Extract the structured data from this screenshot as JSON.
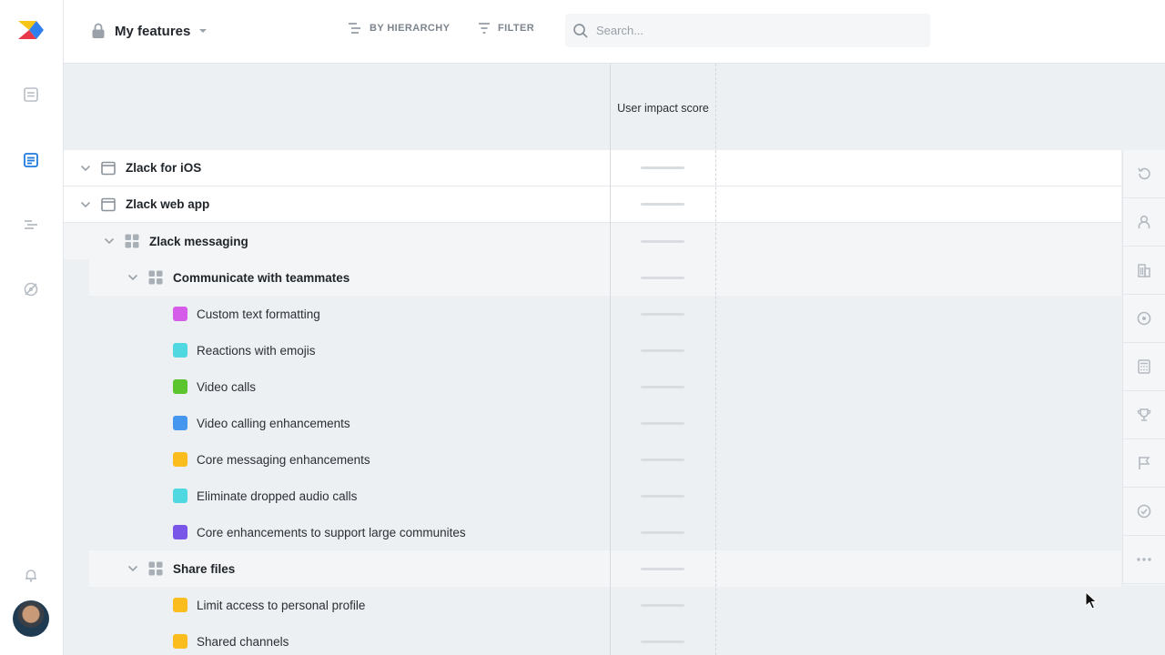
{
  "header": {
    "title": "My features",
    "by_hierarchy_label": "BY HIERARCHY",
    "filter_label": "FILTER",
    "search_placeholder": "Search..."
  },
  "table": {
    "column_header": "User impact score",
    "rows": [
      {
        "label": "Zlack for iOS",
        "level": 0,
        "type": "product"
      },
      {
        "label": "Zlack web app",
        "level": 0,
        "type": "product"
      },
      {
        "label": "Zlack messaging",
        "level": 1,
        "type": "component"
      },
      {
        "label": "Communicate with teammates",
        "level": 2,
        "type": "component"
      },
      {
        "label": "Custom text formatting",
        "level": 3,
        "type": "feature",
        "color": "#d55ce8"
      },
      {
        "label": "Reactions with emojis",
        "level": 3,
        "type": "feature",
        "color": "#4fd8e0"
      },
      {
        "label": "Video calls",
        "level": 3,
        "type": "feature",
        "color": "#5cc42c"
      },
      {
        "label": "Video calling enhancements",
        "level": 3,
        "type": "feature",
        "color": "#4596ef"
      },
      {
        "label": "Core messaging enhancements",
        "level": 3,
        "type": "feature",
        "color": "#fbbd1d"
      },
      {
        "label": "Eliminate dropped audio calls",
        "level": 3,
        "type": "feature",
        "color": "#4fd8e0"
      },
      {
        "label": "Core enhancements to support large communites",
        "level": 3,
        "type": "feature",
        "color": "#7a56e8"
      },
      {
        "label": "Share files",
        "level": 2,
        "type": "component"
      },
      {
        "label": "Limit access to personal profile",
        "level": 3,
        "type": "feature",
        "color": "#fbbd1d"
      },
      {
        "label": "Shared channels",
        "level": 3,
        "type": "feature",
        "color": "#fbbd1d"
      }
    ]
  },
  "right_rail": {
    "icons": [
      "history-icon",
      "user-icon",
      "building-icon",
      "target-icon",
      "calculator-icon",
      "trophy-icon",
      "flag-icon",
      "check-circle-icon",
      "more-icon"
    ]
  },
  "left_nav": {
    "icons": [
      "notes-icon",
      "features-icon",
      "roadmap-icon",
      "insights-icon",
      "bell-icon"
    ]
  }
}
